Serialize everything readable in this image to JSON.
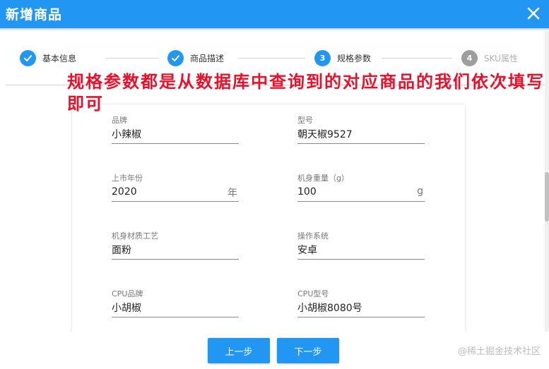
{
  "dialog": {
    "title": "新增商品",
    "close_icon": "close-icon"
  },
  "stepper": {
    "steps": [
      {
        "number": "✓",
        "label": "基本信息",
        "state": "done"
      },
      {
        "number": "✓",
        "label": "商品描述",
        "state": "done"
      },
      {
        "number": "3",
        "label": "规格参数",
        "state": "active"
      },
      {
        "number": "4",
        "label": "SKU属性",
        "state": "pending"
      }
    ]
  },
  "annotation": {
    "text": "规格参数都是从数据库中查询到的对应商品的我们依次填写即可"
  },
  "form": {
    "brand": {
      "label": "品牌",
      "value": "小辣椒"
    },
    "model": {
      "label": "型号",
      "value": "朝天椒9527"
    },
    "year": {
      "label": "上市年份",
      "value": "2020",
      "suffix": "年"
    },
    "weight": {
      "label": "机身重量（g）",
      "value": "100",
      "suffix": "g"
    },
    "material": {
      "label": "机身材质工艺",
      "value": "面粉"
    },
    "os": {
      "label": "操作系统",
      "value": "安卓"
    },
    "cpu_brand": {
      "label": "CPU品牌",
      "value": "小胡椒"
    },
    "cpu_model": {
      "label": "CPU型号",
      "value": "小胡椒8080号"
    }
  },
  "footer": {
    "prev_label": "上一步",
    "next_label": "下一步"
  },
  "watermark": {
    "text": "@稀土掘金技术社区"
  },
  "colors": {
    "primary": "#2196f3",
    "annotation": "#e8102a",
    "pending": "#9e9e9e"
  }
}
